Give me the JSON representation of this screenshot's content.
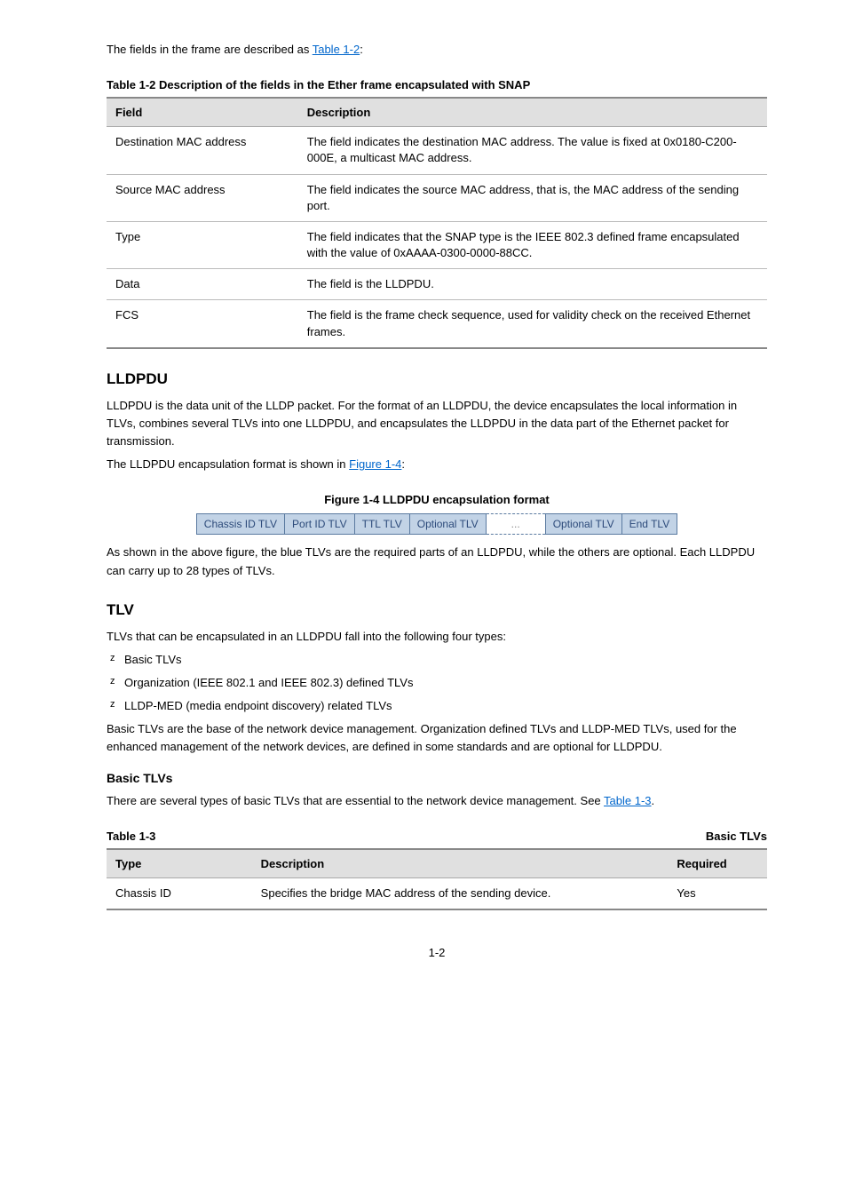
{
  "intro": "The fields in the frame are described as Table 1-2:",
  "table2": {
    "caption": "Table 1-2 Description of the fields in the Ether frame encapsulated with SNAP",
    "headers": [
      "Field",
      "Description"
    ],
    "rows": [
      {
        "f": "Destination MAC address",
        "d": "The field indicates the destination MAC address. The value is fixed at 0x0180-C200-000E, a multicast MAC address."
      },
      {
        "f": "Source MAC address",
        "d": "The field indicates the source MAC address, that is, the MAC address of the sending port."
      },
      {
        "f": "Type",
        "d": "The field indicates that the SNAP type is the IEEE 802.3 defined frame encapsulated with the value of 0xAAAA-0300-0000-88CC."
      },
      {
        "f": "Data",
        "d": "The field is the LLDPDU."
      },
      {
        "f": "FCS",
        "d": "The field is the frame check sequence, used for validity check on the received Ethernet frames."
      }
    ]
  },
  "lldpdu": {
    "heading": "LLDPDU",
    "p1": "LLDPDU is the data unit of the LLDP packet. For the format of an LLDPDU, the device encapsulates the local information in TLVs, combines several TLVs into one LLDPDU, and encapsulates the LLDPDU in the data part of the Ethernet packet for transmission.",
    "p2_prefix": "The LLDPDU encapsulation format is shown in ",
    "p2_link": "Figure 1-4",
    "p2_suffix": ":",
    "fig_caption": "Figure 1-4 LLDPDU encapsulation format",
    "cells": [
      "Chassis ID TLV",
      "Port ID TLV",
      "TTL TLV",
      "Optional TLV",
      "...",
      "Optional TLV",
      "End TLV"
    ],
    "p3": "As shown in the above figure, the blue TLVs are the required parts of an LLDPDU, while the others are optional. Each LLDPDU can carry up to 28 types of TLVs."
  },
  "tlv": {
    "heading": "TLV",
    "p1": "TLVs that can be encapsulated in an LLDPDU fall into the following four types:",
    "li1": "Basic TLVs",
    "li2": "Organization (IEEE 802.1 and IEEE 802.3) defined TLVs",
    "li3": "LLDP-MED (media endpoint discovery) related TLVs",
    "p2": "Basic TLVs are the base of the network device management. Organization defined TLVs and LLDP-MED TLVs, used for the enhanced management of the network devices, are defined in some standards and are optional for LLDPDU.",
    "b1": "Basic TLVs",
    "b1_prefix": "There are several types of basic TLVs that are essential to the network device management. See ",
    "b1_link": "Table 1-3",
    "b1_suffix": "."
  },
  "table3": {
    "caption_left": "Table 1-3",
    "caption_right": "Basic TLVs",
    "headers": [
      "Type",
      "Description",
      "Required"
    ],
    "row1": {
      "t": "Chassis ID",
      "d": "Specifies the bridge MAC address of the sending device.",
      "r": "Yes"
    }
  },
  "page_number": "1-2"
}
